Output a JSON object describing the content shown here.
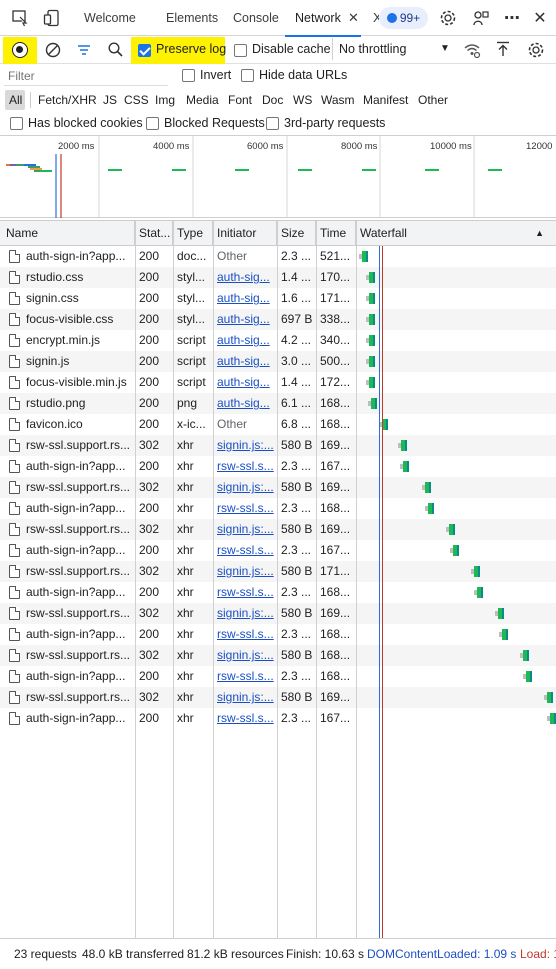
{
  "tabbar": {
    "tabs": [
      {
        "label": "Welcome"
      },
      {
        "label": "Elements"
      },
      {
        "label": "Console"
      },
      {
        "label": "Network"
      },
      {
        "label": "X"
      }
    ],
    "close_glyph": "✕",
    "badge": "99+"
  },
  "toolbar": {
    "preserve_log": "Preserve log",
    "disable_cache": "Disable cache",
    "throttling": "No throttling"
  },
  "filter": {
    "placeholder": "Filter",
    "invert": "Invert",
    "hide_data_urls": "Hide data URLs"
  },
  "types": [
    "All",
    "Fetch/XHR",
    "JS",
    "CSS",
    "Img",
    "Media",
    "Font",
    "Doc",
    "WS",
    "Wasm",
    "Manifest",
    "Other"
  ],
  "blocking": {
    "blocked_cookies": "Has blocked cookies",
    "blocked_requests": "Blocked Requests",
    "third_party": "3rd-party requests"
  },
  "overview": {
    "ticks": [
      "2000 ms",
      "4000 ms",
      "6000 ms",
      "8000 ms",
      "10000 ms",
      "12000"
    ]
  },
  "columns": {
    "name": "Name",
    "status": "Stat...",
    "type": "Type",
    "initiator": "Initiator",
    "size": "Size",
    "time": "Time",
    "waterfall": "Waterfall"
  },
  "requests": [
    {
      "name": "auth-sign-in?app...",
      "status": "200",
      "type": "doc...",
      "initiator": "Other",
      "initiator_link": false,
      "size": "2.3 ...",
      "time": "521..."
    },
    {
      "name": "rstudio.css",
      "status": "200",
      "type": "styl...",
      "initiator": "auth-sig...",
      "initiator_link": true,
      "size": "1.4 ...",
      "time": "170..."
    },
    {
      "name": "signin.css",
      "status": "200",
      "type": "styl...",
      "initiator": "auth-sig...",
      "initiator_link": true,
      "size": "1.6 ...",
      "time": "171..."
    },
    {
      "name": "focus-visible.css",
      "status": "200",
      "type": "styl...",
      "initiator": "auth-sig...",
      "initiator_link": true,
      "size": "697 B",
      "time": "338..."
    },
    {
      "name": "encrypt.min.js",
      "status": "200",
      "type": "script",
      "initiator": "auth-sig...",
      "initiator_link": true,
      "size": "4.2 ...",
      "time": "340..."
    },
    {
      "name": "signin.js",
      "status": "200",
      "type": "script",
      "initiator": "auth-sig...",
      "initiator_link": true,
      "size": "3.0 ...",
      "time": "500..."
    },
    {
      "name": "focus-visible.min.js",
      "status": "200",
      "type": "script",
      "initiator": "auth-sig...",
      "initiator_link": true,
      "size": "1.4 ...",
      "time": "172..."
    },
    {
      "name": "rstudio.png",
      "status": "200",
      "type": "png",
      "initiator": "auth-sig...",
      "initiator_link": true,
      "size": "6.1 ...",
      "time": "168..."
    },
    {
      "name": "favicon.ico",
      "status": "200",
      "type": "x-ic...",
      "initiator": "Other",
      "initiator_link": false,
      "size": "6.8 ...",
      "time": "168..."
    },
    {
      "name": "rsw-ssl.support.rs...",
      "status": "302",
      "type": "xhr",
      "initiator": "signin.js:...",
      "initiator_link": true,
      "size": "580 B",
      "time": "169..."
    },
    {
      "name": "auth-sign-in?app...",
      "status": "200",
      "type": "xhr",
      "initiator": "rsw-ssl.s...",
      "initiator_link": true,
      "size": "2.3 ...",
      "time": "167..."
    },
    {
      "name": "rsw-ssl.support.rs...",
      "status": "302",
      "type": "xhr",
      "initiator": "signin.js:...",
      "initiator_link": true,
      "size": "580 B",
      "time": "169..."
    },
    {
      "name": "auth-sign-in?app...",
      "status": "200",
      "type": "xhr",
      "initiator": "rsw-ssl.s...",
      "initiator_link": true,
      "size": "2.3 ...",
      "time": "168..."
    },
    {
      "name": "rsw-ssl.support.rs...",
      "status": "302",
      "type": "xhr",
      "initiator": "signin.js:...",
      "initiator_link": true,
      "size": "580 B",
      "time": "169..."
    },
    {
      "name": "auth-sign-in?app...",
      "status": "200",
      "type": "xhr",
      "initiator": "rsw-ssl.s...",
      "initiator_link": true,
      "size": "2.3 ...",
      "time": "167..."
    },
    {
      "name": "rsw-ssl.support.rs...",
      "status": "302",
      "type": "xhr",
      "initiator": "signin.js:...",
      "initiator_link": true,
      "size": "580 B",
      "time": "171..."
    },
    {
      "name": "auth-sign-in?app...",
      "status": "200",
      "type": "xhr",
      "initiator": "rsw-ssl.s...",
      "initiator_link": true,
      "size": "2.3 ...",
      "time": "168..."
    },
    {
      "name": "rsw-ssl.support.rs...",
      "status": "302",
      "type": "xhr",
      "initiator": "signin.js:...",
      "initiator_link": true,
      "size": "580 B",
      "time": "169..."
    },
    {
      "name": "auth-sign-in?app...",
      "status": "200",
      "type": "xhr",
      "initiator": "rsw-ssl.s...",
      "initiator_link": true,
      "size": "2.3 ...",
      "time": "168..."
    },
    {
      "name": "rsw-ssl.support.rs...",
      "status": "302",
      "type": "xhr",
      "initiator": "signin.js:...",
      "initiator_link": true,
      "size": "580 B",
      "time": "168..."
    },
    {
      "name": "auth-sign-in?app...",
      "status": "200",
      "type": "xhr",
      "initiator": "rsw-ssl.s...",
      "initiator_link": true,
      "size": "2.3 ...",
      "time": "168..."
    },
    {
      "name": "rsw-ssl.support.rs...",
      "status": "302",
      "type": "xhr",
      "initiator": "signin.js:...",
      "initiator_link": true,
      "size": "580 B",
      "time": "169..."
    },
    {
      "name": "auth-sign-in?app...",
      "status": "200",
      "type": "xhr",
      "initiator": "rsw-ssl.s...",
      "initiator_link": true,
      "size": "2.3 ...",
      "time": "167..."
    }
  ],
  "status": {
    "requests": "23 requests",
    "transferred": "48.0 kB transferred",
    "resources": "81.2 kB resources",
    "finish": "Finish: 10.63 s",
    "dcl": "DOMContentLoaded: 1.09 s",
    "load": "Load: 1"
  },
  "colors": {
    "accent": "#1a73e8",
    "highlight": "#fff200",
    "waiting": "#1db954",
    "download": "#0a8a8a",
    "dcl_line": "#2d6cdf",
    "load_line": "#c0392b"
  }
}
